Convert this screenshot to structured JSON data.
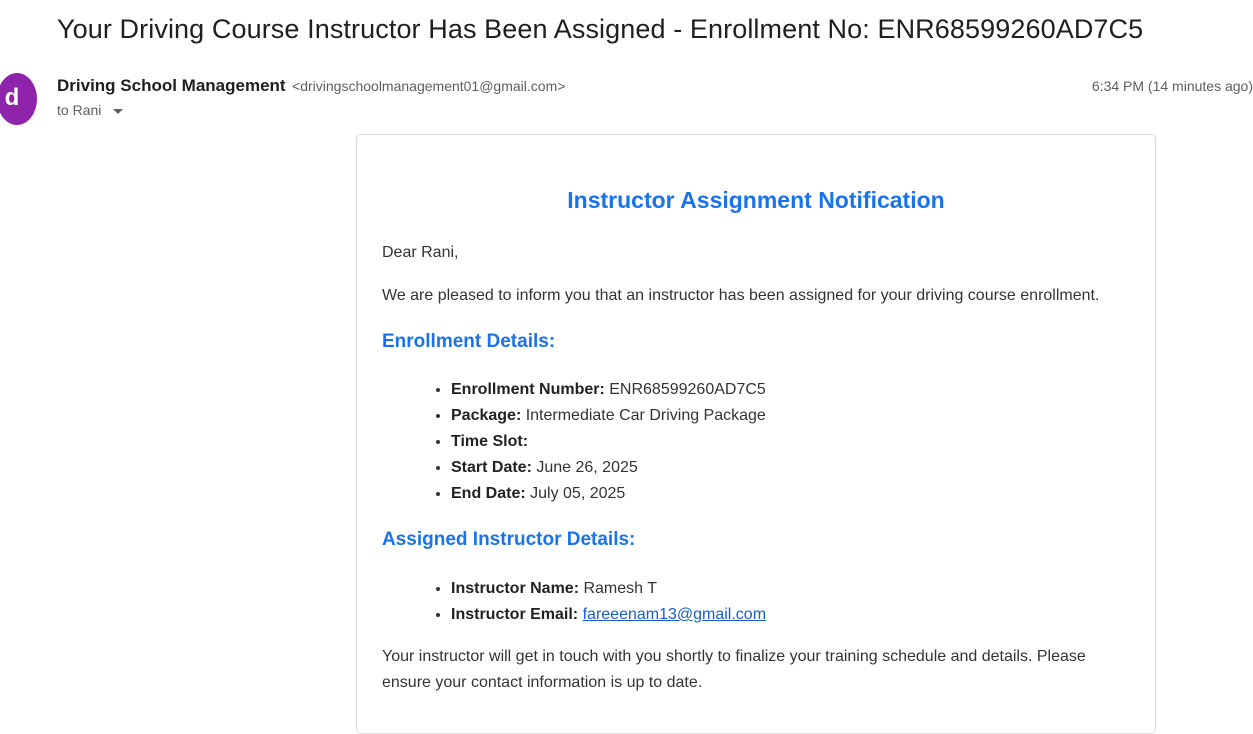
{
  "email": {
    "subject": "Your Driving Course Instructor Has Been Assigned - Enrollment No: ENR68599260AD7C5",
    "sender_initial": "d",
    "sender_name": "Driving School Management",
    "sender_email": "<drivingschoolmanagement01@gmail.com>",
    "to": "to Rani",
    "timestamp": "6:34 PM (14 minutes ago)"
  },
  "body": {
    "heading": "Instructor Assignment Notification",
    "greeting": "Dear Rani,",
    "intro": "We are pleased to inform you that an instructor has been assigned for your driving course enrollment.",
    "enrollment_title": "Enrollment Details:",
    "enrollment": [
      {
        "label": "Enrollment Number:",
        "value": " ENR68599260AD7C5"
      },
      {
        "label": "Package:",
        "value": " Intermediate Car Driving Package"
      },
      {
        "label": "Time Slot:",
        "value": ""
      },
      {
        "label": "Start Date:",
        "value": " June 26, 2025"
      },
      {
        "label": "End Date:",
        "value": " July 05, 2025"
      }
    ],
    "instructor_title": "Assigned Instructor Details:",
    "instructor": {
      "name_label": "Instructor Name:",
      "name_value": " Ramesh T",
      "email_label": "Instructor Email:",
      "email_value": "fareeenam13@gmail.com"
    },
    "closing": "Your instructor will get in touch with you shortly to finalize your training schedule and details. Please ensure your contact information is up to date."
  },
  "colors": {
    "accent": "#1a73e8",
    "avatar": "#8e24aa",
    "link": "#1a5dc8"
  }
}
